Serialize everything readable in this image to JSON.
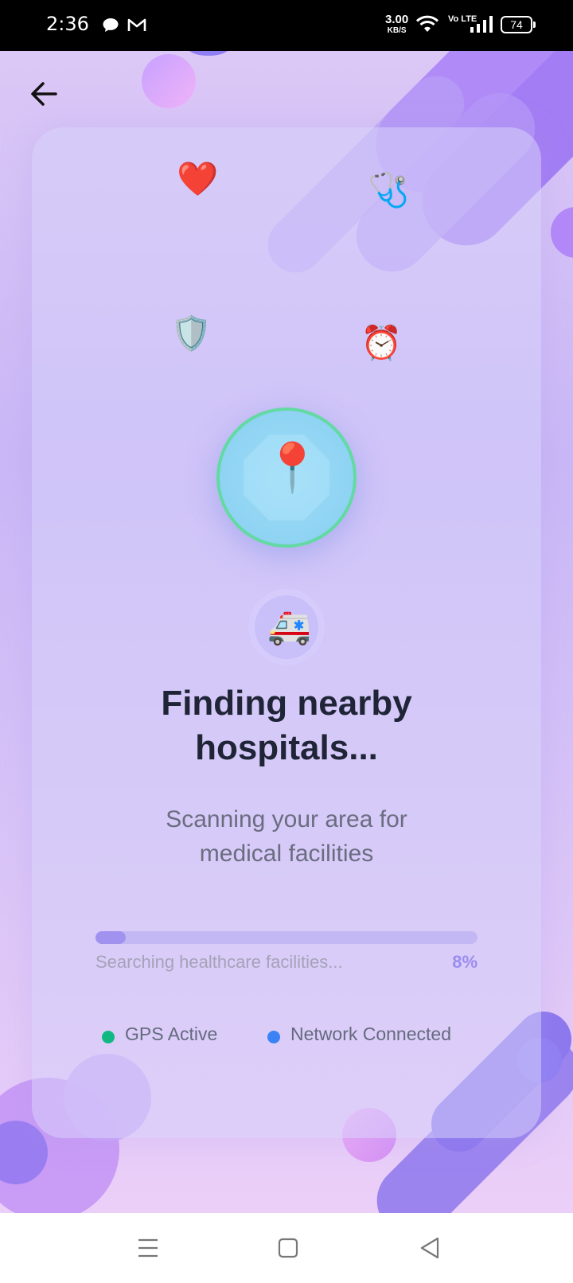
{
  "status_bar": {
    "time": "2:36",
    "net_speed": "3.00",
    "net_speed_unit": "KB/S",
    "volte": "Vo LTE",
    "battery": "74"
  },
  "header": {
    "back_icon": "arrow-left-icon"
  },
  "decor_icons": {
    "heart": "❤️",
    "stethoscope": "🩺",
    "shield": "🛡️",
    "clock": "⏰",
    "pin": "📍",
    "ambulance": "🚑"
  },
  "main": {
    "title_line1": "Finding nearby",
    "title_line2": "hospitals...",
    "subtitle_line1": "Scanning your area for",
    "subtitle_line2": "medical facilities"
  },
  "progress": {
    "label": "Searching healthcare facilities...",
    "percent_text": "8%",
    "percent": 8
  },
  "status": {
    "gps": "GPS Active",
    "network": "Network Connected",
    "gps_color": "#10b981",
    "network_color": "#3b82f6"
  },
  "nav_bar": {
    "menu_icon": "menu-icon",
    "home_icon": "home-square-icon",
    "back_icon": "back-triangle-icon"
  },
  "colors": {
    "accent": "#a192f0",
    "title": "#1f2437"
  }
}
